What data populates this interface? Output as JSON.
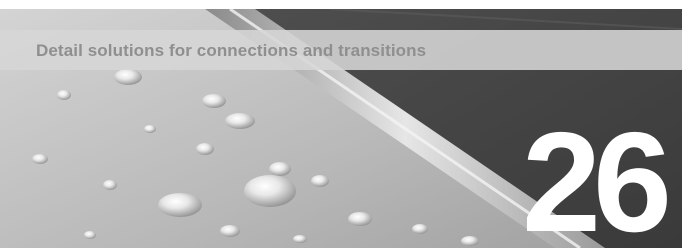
{
  "header": {
    "title": "Detail solutions for connections and transitions"
  },
  "chapter": {
    "number": "26"
  },
  "image": {
    "subject": "water-droplets-on-tile-photo"
  },
  "colors": {
    "title_band": "#d6d6d6",
    "title_text": "#8f8f8f",
    "number_text": "#ffffff"
  }
}
